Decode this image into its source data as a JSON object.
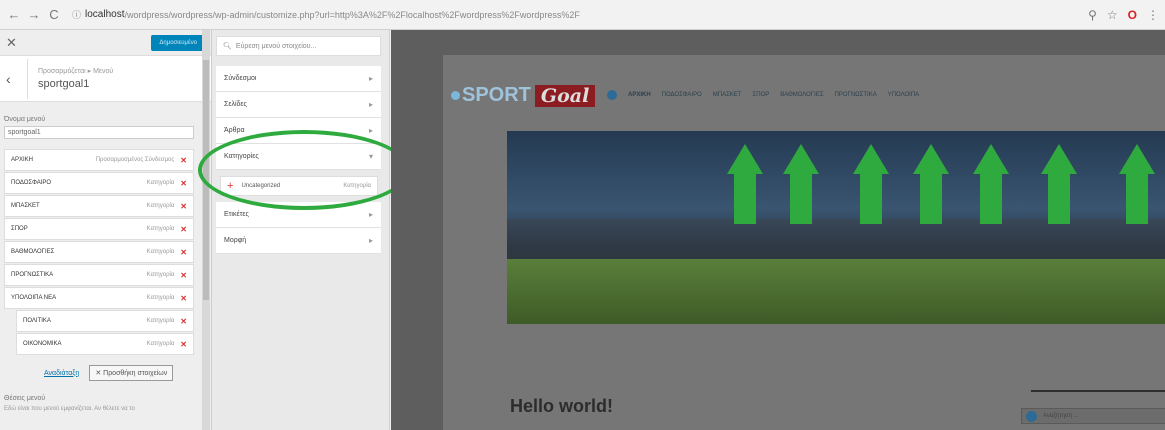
{
  "browser": {
    "host": "localhost",
    "url_rest": "/wordpress/wordpress/wp-admin/customize.php?url=http%3A%2F%2Flocalhost%2Fwordpress%2Fwordpress%2F"
  },
  "customizer": {
    "publish_label": "Δημοσιευμένο",
    "breadcrumb": "Προσαρμόζεται ▸ Μενού",
    "menu_name": "sportgoal1",
    "menu_name_label": "Όνομα μενού",
    "menu_name_value": "sportgoal1",
    "items": [
      {
        "label": "ΑΡΧΙΚΗ",
        "type": "Προσαρμοσμένος Σύνδεσμος",
        "sub": false
      },
      {
        "label": "ΠΟΔΟΣΦΑΙΡΟ",
        "type": "Κατηγορία",
        "sub": false
      },
      {
        "label": "ΜΠΑΣΚΕΤ",
        "type": "Κατηγορία",
        "sub": false
      },
      {
        "label": "ΣΠΟΡ",
        "type": "Κατηγορία",
        "sub": false
      },
      {
        "label": "ΒΑΘΜΟΛΟΓΙΕΣ",
        "type": "Κατηγορία",
        "sub": false
      },
      {
        "label": "ΠΡΟΓΝΩΣΤΙΚΑ",
        "type": "Κατηγορία",
        "sub": false
      },
      {
        "label": "ΥΠΟΛΟΙΠΑ ΝΕΑ",
        "type": "Κατηγορία",
        "sub": false
      },
      {
        "label": "ΠΟΛΙΤΙΚΑ",
        "type": "Κατηγορία",
        "sub": true
      },
      {
        "label": "ΟΙΚΟΝΟΜΙΚΑ",
        "type": "Κατηγορία",
        "sub": true
      }
    ],
    "reorder_label": "Αναδιάταξη",
    "add_items_label": "Προσθήκη στοιχείων",
    "locations_title": "Θέσεις μενού",
    "locations_text": "Εδώ είναι που μενού εμφανίζεται. Αν θέλετε να το"
  },
  "available": {
    "search_placeholder": "Εύρεση μενού στοιχείου...",
    "sections": [
      "Σύνδεσμοι",
      "Σελίδες",
      "Άρθρα",
      "Κατηγορίες",
      "Ετικέτες",
      "Μορφή"
    ],
    "category_item": {
      "label": "Uncategorized",
      "type": "Κατηγορία"
    }
  },
  "preview": {
    "logo_sport": "SPORT",
    "logo_goal": "Goal",
    "nav_items": [
      "ΑΡΧΙΚΗ",
      "ΠΟΔΟΣΦΑΙΡΟ",
      "ΜΠΑΣΚΕΤ",
      "ΣΠΟΡ",
      "ΒΑΘΜΟΛΟΓΙΕΣ",
      "ΠΡΟΓΝΩΣΤΙΚΑ",
      "ΥΠΟΛΟΙΠΑ"
    ],
    "hello": "Hello world!",
    "search_placeholder": "Αναζήτηση ..."
  },
  "colors": {
    "annotation_green": "#2eaa3e",
    "publish_blue": "#0085ba",
    "delete_red": "#dc3232"
  }
}
